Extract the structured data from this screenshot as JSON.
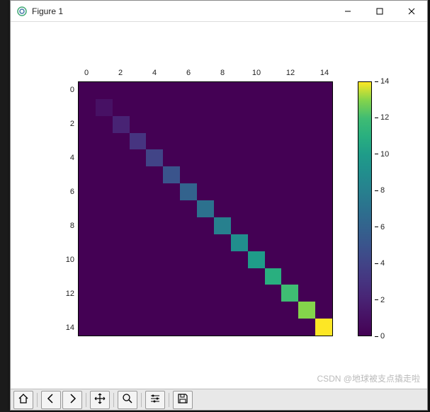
{
  "window": {
    "title": "Figure 1",
    "minimize": "—",
    "maximize": "☐",
    "close": "✕"
  },
  "chart_data": {
    "type": "heatmap",
    "n": 15,
    "matrix_diagonal_values": [
      0,
      1,
      2,
      3,
      4,
      5,
      6,
      7,
      8,
      9,
      10,
      11,
      12,
      13,
      14
    ],
    "off_diagonal_value": 0,
    "cmap": "viridis",
    "x_ticks": [
      0,
      2,
      4,
      6,
      8,
      10,
      12,
      14
    ],
    "y_ticks": [
      0,
      2,
      4,
      6,
      8,
      10,
      12,
      14
    ],
    "colorbar_ticks": [
      0,
      2,
      4,
      6,
      8,
      10,
      12,
      14
    ],
    "vmin": 0,
    "vmax": 14
  },
  "viridis_stops": [
    [
      0.0,
      "#440154"
    ],
    [
      0.071,
      "#471164"
    ],
    [
      0.143,
      "#482374"
    ],
    [
      0.214,
      "#463480"
    ],
    [
      0.286,
      "#414487"
    ],
    [
      0.357,
      "#3a548c"
    ],
    [
      0.429,
      "#33638d"
    ],
    [
      0.5,
      "#2c718e"
    ],
    [
      0.571,
      "#27808e"
    ],
    [
      0.643,
      "#218e8d"
    ],
    [
      0.714,
      "#1f9c89"
    ],
    [
      0.786,
      "#29af7f"
    ],
    [
      0.857,
      "#3fbc73"
    ],
    [
      0.929,
      "#84d44b"
    ],
    [
      1.0,
      "#fde725"
    ]
  ],
  "watermark": "CSDN @地球被支点撬走啦",
  "toolbar": {
    "home": "home-icon",
    "back": "back-icon",
    "forward": "forward-icon",
    "pan": "pan-icon",
    "zoom": "zoom-icon",
    "subplots": "subplots-icon",
    "save": "save-icon"
  }
}
